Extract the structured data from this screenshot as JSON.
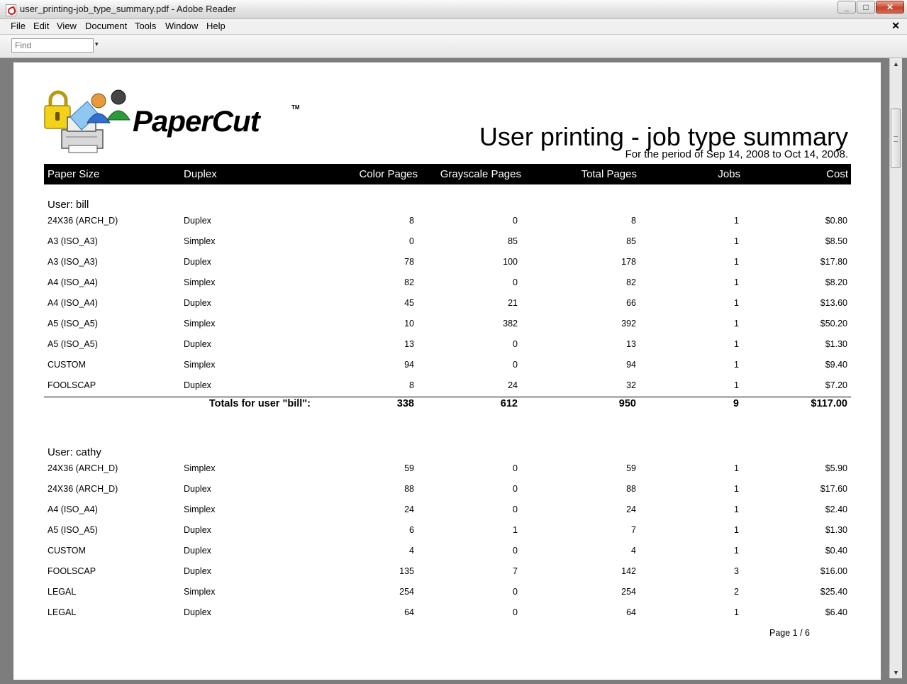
{
  "window": {
    "title": "user_printing-job_type_summary.pdf - Adobe Reader",
    "controls": {
      "minimize": "_",
      "maximize": "□",
      "close": "✕"
    }
  },
  "menubar": {
    "items": [
      "File",
      "Edit",
      "View",
      "Document",
      "Tools",
      "Window",
      "Help"
    ],
    "close_glyph": "✕"
  },
  "toolbar": {
    "find_placeholder": "Find",
    "find_dropdown_glyph": "▾"
  },
  "report": {
    "logo_text": "PaperCut",
    "logo_tm": "TM",
    "title": "User printing - job type summary",
    "period": "For the period of Sep 14, 2008 to Oct 14, 2008.",
    "columns": [
      "Paper Size",
      "Duplex",
      "Color Pages",
      "Grayscale Pages",
      "Total Pages",
      "Jobs",
      "Cost"
    ],
    "users": [
      {
        "label": "User: bill",
        "rows": [
          [
            "24X36 (ARCH_D)",
            "Duplex",
            "8",
            "0",
            "8",
            "1",
            "$0.80"
          ],
          [
            "A3 (ISO_A3)",
            "Simplex",
            "0",
            "85",
            "85",
            "1",
            "$8.50"
          ],
          [
            "A3 (ISO_A3)",
            "Duplex",
            "78",
            "100",
            "178",
            "1",
            "$17.80"
          ],
          [
            "A4 (ISO_A4)",
            "Simplex",
            "82",
            "0",
            "82",
            "1",
            "$8.20"
          ],
          [
            "A4 (ISO_A4)",
            "Duplex",
            "45",
            "21",
            "66",
            "1",
            "$13.60"
          ],
          [
            "A5 (ISO_A5)",
            "Simplex",
            "10",
            "382",
            "392",
            "1",
            "$50.20"
          ],
          [
            "A5 (ISO_A5)",
            "Duplex",
            "13",
            "0",
            "13",
            "1",
            "$1.30"
          ],
          [
            "CUSTOM",
            "Simplex",
            "94",
            "0",
            "94",
            "1",
            "$9.40"
          ],
          [
            "FOOLSCAP",
            "Duplex",
            "8",
            "24",
            "32",
            "1",
            "$7.20"
          ]
        ],
        "totals": {
          "label": "Totals for user \"bill\":",
          "values": [
            "338",
            "612",
            "950",
            "9",
            "$117.00"
          ]
        }
      },
      {
        "label": "User: cathy",
        "rows": [
          [
            "24X36 (ARCH_D)",
            "Simplex",
            "59",
            "0",
            "59",
            "1",
            "$5.90"
          ],
          [
            "24X36 (ARCH_D)",
            "Duplex",
            "88",
            "0",
            "88",
            "1",
            "$17.60"
          ],
          [
            "A4 (ISO_A4)",
            "Simplex",
            "24",
            "0",
            "24",
            "1",
            "$2.40"
          ],
          [
            "A5 (ISO_A5)",
            "Duplex",
            "6",
            "1",
            "7",
            "1",
            "$1.30"
          ],
          [
            "CUSTOM",
            "Duplex",
            "4",
            "0",
            "4",
            "1",
            "$0.40"
          ],
          [
            "FOOLSCAP",
            "Duplex",
            "135",
            "7",
            "142",
            "3",
            "$16.00"
          ],
          [
            "LEGAL",
            "Simplex",
            "254",
            "0",
            "254",
            "2",
            "$25.40"
          ],
          [
            "LEGAL",
            "Duplex",
            "64",
            "0",
            "64",
            "1",
            "$6.40"
          ]
        ]
      }
    ],
    "page_number": "Page 1  / 6"
  },
  "scrollbar": {
    "up_glyph": "▲",
    "down_glyph": "▼"
  }
}
